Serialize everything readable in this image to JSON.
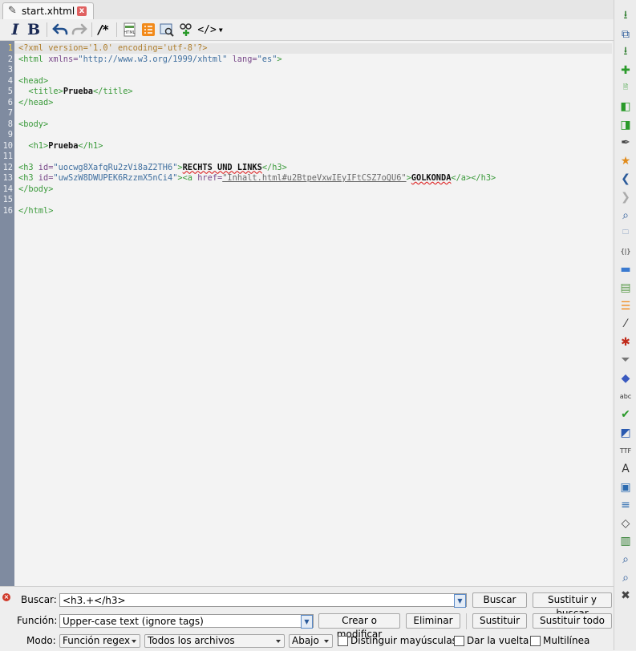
{
  "tab": {
    "label": "start.xhtml",
    "close": "x"
  },
  "toolbar": {
    "italic": "I",
    "bold": "B",
    "comment": "/*",
    "code": "</>"
  },
  "editor": {
    "lines": [
      {
        "n": "1",
        "current": true,
        "parts": [
          {
            "c": "pi",
            "t": "<?xml version='1.0' encoding='utf-8'?>"
          }
        ]
      },
      {
        "n": "2",
        "parts": [
          {
            "c": "tag",
            "t": "<html"
          },
          {
            "c": "attr",
            "t": " xmlns="
          },
          {
            "c": "val",
            "t": "\"http://www.w3.org/1999/xhtml\""
          },
          {
            "c": "attr",
            "t": " lang="
          },
          {
            "c": "val",
            "t": "\"es\""
          },
          {
            "c": "tag",
            "t": ">"
          }
        ]
      },
      {
        "n": "3",
        "parts": []
      },
      {
        "n": "4",
        "parts": [
          {
            "c": "tag",
            "t": "<head>"
          }
        ]
      },
      {
        "n": "5",
        "parts": [
          {
            "c": "plain",
            "t": "  "
          },
          {
            "c": "tag",
            "t": "<title>"
          },
          {
            "c": "text",
            "t": "Prueba"
          },
          {
            "c": "tag",
            "t": "</title>"
          }
        ]
      },
      {
        "n": "6",
        "parts": [
          {
            "c": "tag",
            "t": "</head>"
          }
        ]
      },
      {
        "n": "7",
        "parts": []
      },
      {
        "n": "8",
        "parts": [
          {
            "c": "tag",
            "t": "<body>"
          }
        ]
      },
      {
        "n": "9",
        "parts": []
      },
      {
        "n": "10",
        "parts": [
          {
            "c": "plain",
            "t": "  "
          },
          {
            "c": "tag",
            "t": "<h1>"
          },
          {
            "c": "text",
            "t": "Prueba"
          },
          {
            "c": "tag",
            "t": "</h1>"
          }
        ]
      },
      {
        "n": "11",
        "parts": []
      },
      {
        "n": "12",
        "parts": [
          {
            "c": "tag",
            "t": "<h3"
          },
          {
            "c": "attr",
            "t": " id="
          },
          {
            "c": "val",
            "t": "\"uocwg8XafqRu2zVi8aZ2TH6\""
          },
          {
            "c": "tag",
            "t": ">"
          },
          {
            "c": "textsp",
            "t": "RECHTS UND LINKS"
          },
          {
            "c": "tag",
            "t": "</h3>"
          }
        ]
      },
      {
        "n": "13",
        "parts": [
          {
            "c": "tag",
            "t": "<h3"
          },
          {
            "c": "attr",
            "t": " id="
          },
          {
            "c": "val",
            "t": "\"uwSzW8DWUPEK6RzzmX5nCi4\""
          },
          {
            "c": "tag",
            "t": ">"
          },
          {
            "c": "tag",
            "t": "<a"
          },
          {
            "c": "attr",
            "t": " href="
          },
          {
            "c": "href",
            "t": "\"Inhalt.html#u2BtpeVxwIEyIFtCSZ7oQU6\""
          },
          {
            "c": "tag",
            "t": ">"
          },
          {
            "c": "textsp",
            "t": "GOLKONDA"
          },
          {
            "c": "tag",
            "t": "</a>"
          },
          {
            "c": "tag",
            "t": "</h3>"
          }
        ]
      },
      {
        "n": "14",
        "parts": [
          {
            "c": "tag",
            "t": "</body>"
          }
        ]
      },
      {
        "n": "15",
        "parts": []
      },
      {
        "n": "16",
        "parts": [
          {
            "c": "tag",
            "t": "</html>"
          }
        ]
      }
    ]
  },
  "search": {
    "find_label": "Buscar:",
    "find_value": "<h3.+</h3>",
    "find_button": "Buscar",
    "replace_find_button": "Sustituir y buscar",
    "function_label": "Función:",
    "function_value": "Upper-case text (ignore tags)",
    "create_button": "Crear o modificar",
    "delete_button": "Eliminar",
    "replace_button": "Sustituir",
    "replace_all_button": "Sustituir todo",
    "mode_label": "Modo:",
    "mode_value": "Función regex",
    "scope_value": "Todos los archivos",
    "direction_value": "Abajo",
    "case_label": "Distinguir mayúsculas",
    "wrap_label": "Dar la vuelta",
    "multiline_label": "Multilínea",
    "close": "×"
  },
  "colors": {
    "gutter": "#7f8ba0",
    "current_line_number": "#ffd54a",
    "tag": "#3a9a3a",
    "attr": "#7a4a8a",
    "value": "#3f6f9f"
  },
  "right_toolbar_icons": [
    "download-icon",
    "copy-icon",
    "download-alt-icon",
    "add-icon",
    "add-file-icon",
    "add-prev-icon",
    "add-next-icon",
    "feather-icon",
    "pin-icon",
    "back-icon",
    "forward-icon",
    "search-icon",
    "folder-search-icon",
    "braces-icon",
    "folder-icon",
    "html-icon",
    "checklist-icon",
    "wand-icon",
    "bug-icon",
    "filter-icon",
    "eraser-icon",
    "spellcheck-icon",
    "check-icon",
    "book-icon",
    "ttf-icon",
    "font-icon",
    "save-icon",
    "sort-icon",
    "tag-icon",
    "chart-icon",
    "image-search-icon",
    "bookmark-search-icon",
    "tools-icon"
  ]
}
